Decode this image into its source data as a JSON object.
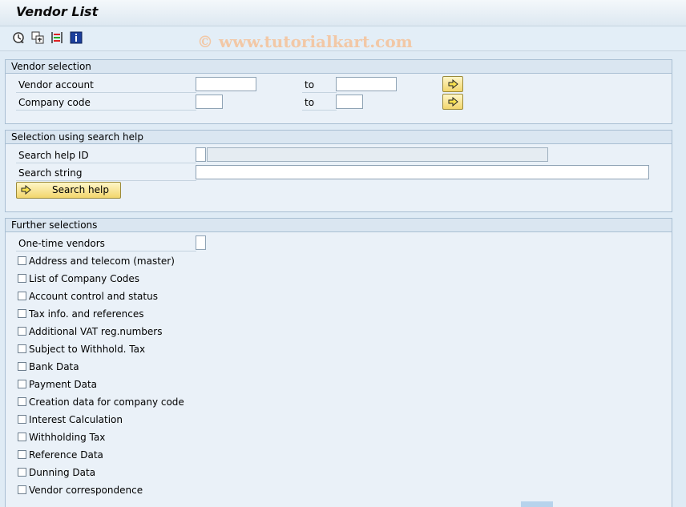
{
  "window": {
    "title": "Vendor List"
  },
  "toolbar": {
    "buttons": [
      {
        "icon": "execute-icon"
      },
      {
        "icon": "save-variant-icon"
      },
      {
        "icon": "selection-options-icon"
      },
      {
        "icon": "info-icon"
      }
    ]
  },
  "watermark": "© www.tutorialkart.com",
  "vendor_selection": {
    "title": "Vendor selection",
    "vendor_account": {
      "label": "Vendor account",
      "from": "",
      "to": ""
    },
    "company_code": {
      "label": "Company code",
      "from": "",
      "to": ""
    },
    "to_label": "to"
  },
  "search_help": {
    "title": "Selection using search help",
    "search_help_id": {
      "label": "Search help ID",
      "value": "",
      "description": ""
    },
    "search_string": {
      "label": "Search string",
      "value": ""
    },
    "button_label": "Search help"
  },
  "further": {
    "title": "Further selections",
    "one_time": {
      "label": "One-time vendors",
      "value": ""
    },
    "checkboxes": [
      "Address and telecom (master)",
      "List of Company Codes",
      "Account control and status",
      "Tax info. and references",
      "Additional VAT reg.numbers",
      "Subject to Withhold. Tax",
      "Bank Data",
      "Payment Data",
      "Creation data for company code",
      "Interest Calculation",
      "Withholding Tax",
      "Reference Data",
      "Dunning Data",
      "Vendor correspondence"
    ]
  },
  "colors": {
    "background": "#dfebf5",
    "group_header": "#dae6f1",
    "button_yellow": "#f2d66c"
  }
}
